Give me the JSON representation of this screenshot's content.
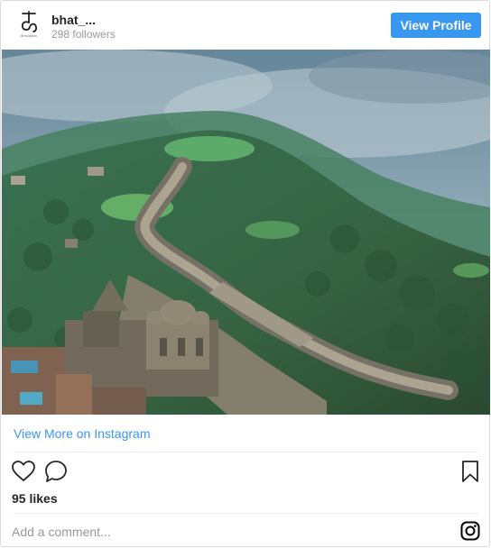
{
  "header": {
    "avatar_caption": "dhrupadx",
    "username": "bhat_...",
    "followers": "298 followers",
    "view_profile_label": "View Profile"
  },
  "photo": {
    "description_icon": "photo-fortress-wall"
  },
  "view_more_label": "View More on Instagram",
  "actions": {
    "like_icon": "heart-icon",
    "comment_icon": "comment-icon",
    "save_icon": "bookmark-icon"
  },
  "likes": "95 likes",
  "comment": {
    "placeholder": "Add a comment..."
  },
  "colors": {
    "accent": "#3897f0",
    "border": "#dbdbdb",
    "muted": "#999999",
    "text": "#262626"
  }
}
